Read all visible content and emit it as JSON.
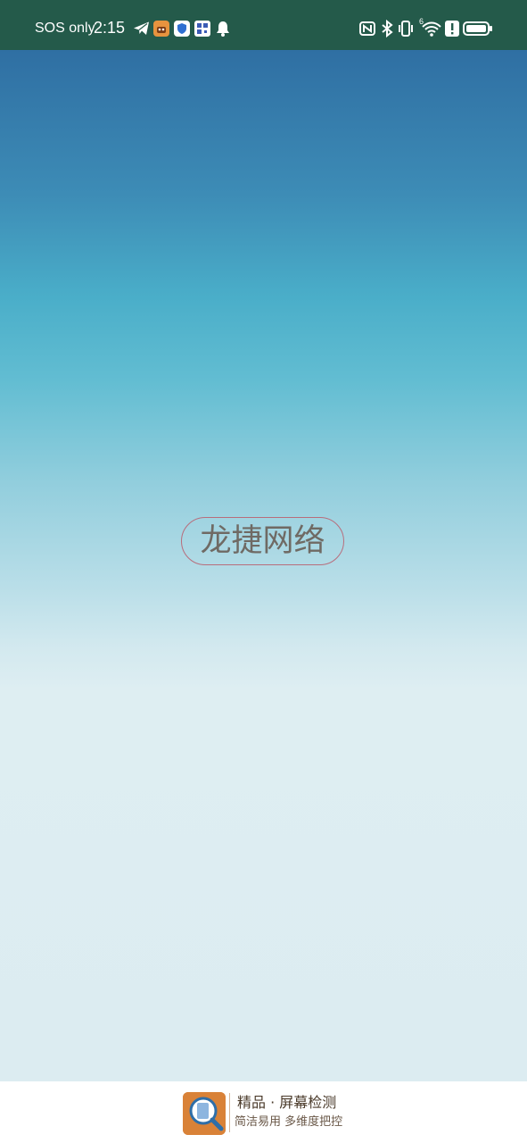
{
  "status_bar": {
    "carrier": "SOS only",
    "time": "2:15",
    "left_icons": [
      "telegram-icon",
      "orange-app-icon",
      "shield-app-icon",
      "qr-app-icon",
      "notification-bell-icon"
    ],
    "right_icons": [
      "nfc-icon",
      "bluetooth-icon",
      "vibrate-icon",
      "wifi-icon",
      "alert-icon",
      "battery-icon"
    ],
    "wifi_badge": "6"
  },
  "splash": {
    "brand_name": "龙捷网络"
  },
  "footer": {
    "title": "精品 · 屏幕检测",
    "subtitle": "简洁易用 多维度把控"
  },
  "colors": {
    "status_bar_bg": "#245a4a",
    "gradient_top": "#2f6fa3",
    "gradient_mid": "#4aaec9",
    "gradient_bottom": "#dcecf1",
    "brand_border": "#b86d7c",
    "brand_text": "#6f6a64",
    "footer_logo": "#d98238"
  }
}
